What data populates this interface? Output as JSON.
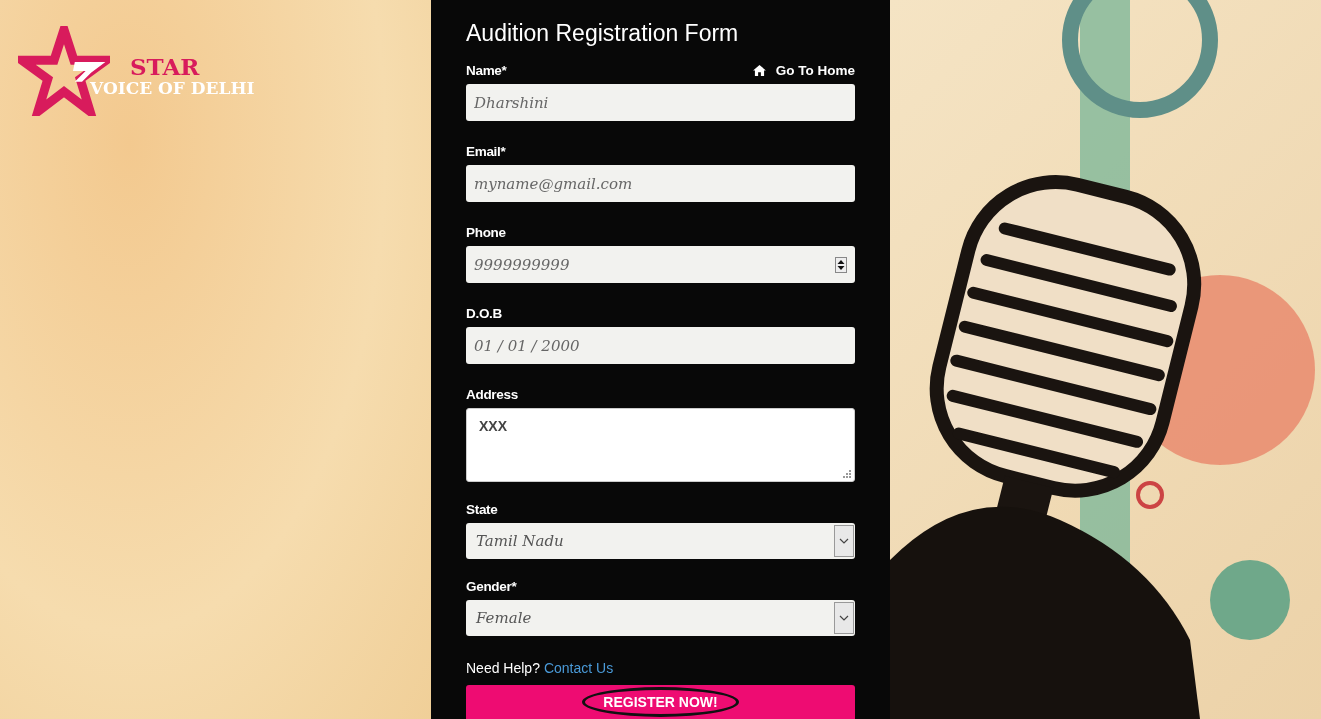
{
  "logo": {
    "line_1": "STAR",
    "line_2": "VOICE OF DELHI"
  },
  "form": {
    "title": "Audition Registration Form",
    "home_link": "Go To Home",
    "fields": [
      {
        "kind": "text",
        "label": "Name*",
        "placeholder": "Dharshini"
      },
      {
        "kind": "text",
        "label": "Email*",
        "placeholder": "myname@gmail.com"
      },
      {
        "kind": "number",
        "label": "Phone",
        "placeholder": "9999999999"
      },
      {
        "kind": "text",
        "label": "D.O.B",
        "placeholder": "01 / 01 / 2000"
      },
      {
        "kind": "textarea",
        "label": "Address",
        "value": "XXX"
      },
      {
        "kind": "select",
        "label": "State",
        "value": "Tamil Nadu"
      },
      {
        "kind": "select",
        "label": "Gender*",
        "value": "Female"
      }
    ],
    "help_text": "Need Help?",
    "help_link": "Contact Us",
    "submit": "REGISTER NOW!"
  }
}
